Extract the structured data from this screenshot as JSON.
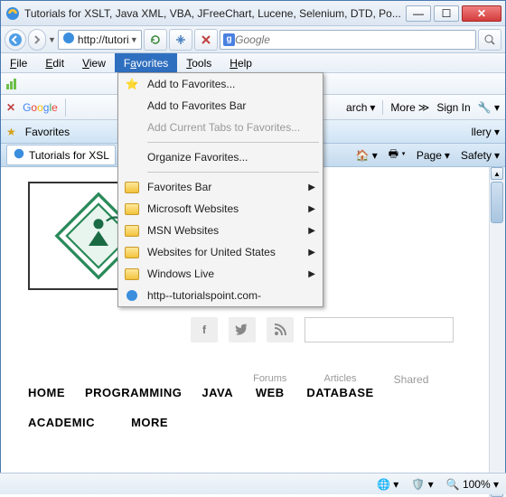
{
  "title": "Tutorials for XSLT, Java XML, VBA, JFreeChart, Lucene, Selenium, DTD, Po...",
  "address": "http://tutori...",
  "search_placeholder": "Google",
  "menubar": {
    "file": "File",
    "edit": "Edit",
    "view": "View",
    "favorites": "Favorites",
    "tools": "Tools",
    "help": "Help"
  },
  "favmenu": {
    "add": "Add to Favorites...",
    "addbar": "Add to Favorites Bar",
    "addtabs": "Add Current Tabs to Favorites...",
    "organize": "Organize Favorites...",
    "favbar": "Favorites Bar",
    "ms": "Microsoft Websites",
    "msn": "MSN Websites",
    "us": "Websites for United States",
    "live": "Windows Live",
    "site": "http--tutorialspoint.com-"
  },
  "gbar": {
    "brand": "Google",
    "search": "arch",
    "more": "More",
    "signin": "Sign In"
  },
  "toolbar2": {
    "favorites": "Favorites",
    "llery": "llery"
  },
  "filetab": {
    "tab": "Tutorials for XSL",
    "page": "Page",
    "safety": "Safety"
  },
  "social": {
    "f": "f",
    "t": "❯",
    "r": "⌇"
  },
  "nav": {
    "home": "HOME",
    "programming": "PROGRAMMING",
    "java": "JAVA",
    "forums": "Forums",
    "web": "WEB",
    "articles": "Articles",
    "database": "DATABASE",
    "shared": "Shared",
    "academic": "ACADEMIC",
    "more": "MORE"
  },
  "status": {
    "zoom": "100%"
  }
}
